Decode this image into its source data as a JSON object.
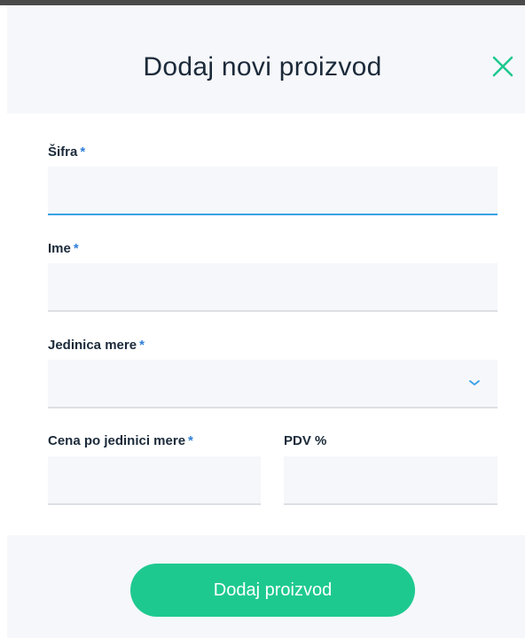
{
  "dialog": {
    "title": "Dodaj novi proizvod",
    "close_icon": "close-icon"
  },
  "colors": {
    "accent": "#1ec98f",
    "required_marker": "#2f7ed8",
    "focus_underline": "#3aa0e6",
    "field_background": "#f6f7fa"
  },
  "fields": {
    "sifra": {
      "label": "Šifra",
      "required_marker": "*",
      "value": ""
    },
    "ime": {
      "label": "Ime",
      "required_marker": "*",
      "value": ""
    },
    "jedinica_mere": {
      "label": "Jedinica mere",
      "required_marker": "*",
      "value": "",
      "icon": "chevron-down-icon"
    },
    "cena": {
      "label": "Cena po jedinici mere",
      "required_marker": "*",
      "value": ""
    },
    "pdv": {
      "label": "PDV %",
      "value": ""
    }
  },
  "footer": {
    "submit_label": "Dodaj proizvod"
  }
}
